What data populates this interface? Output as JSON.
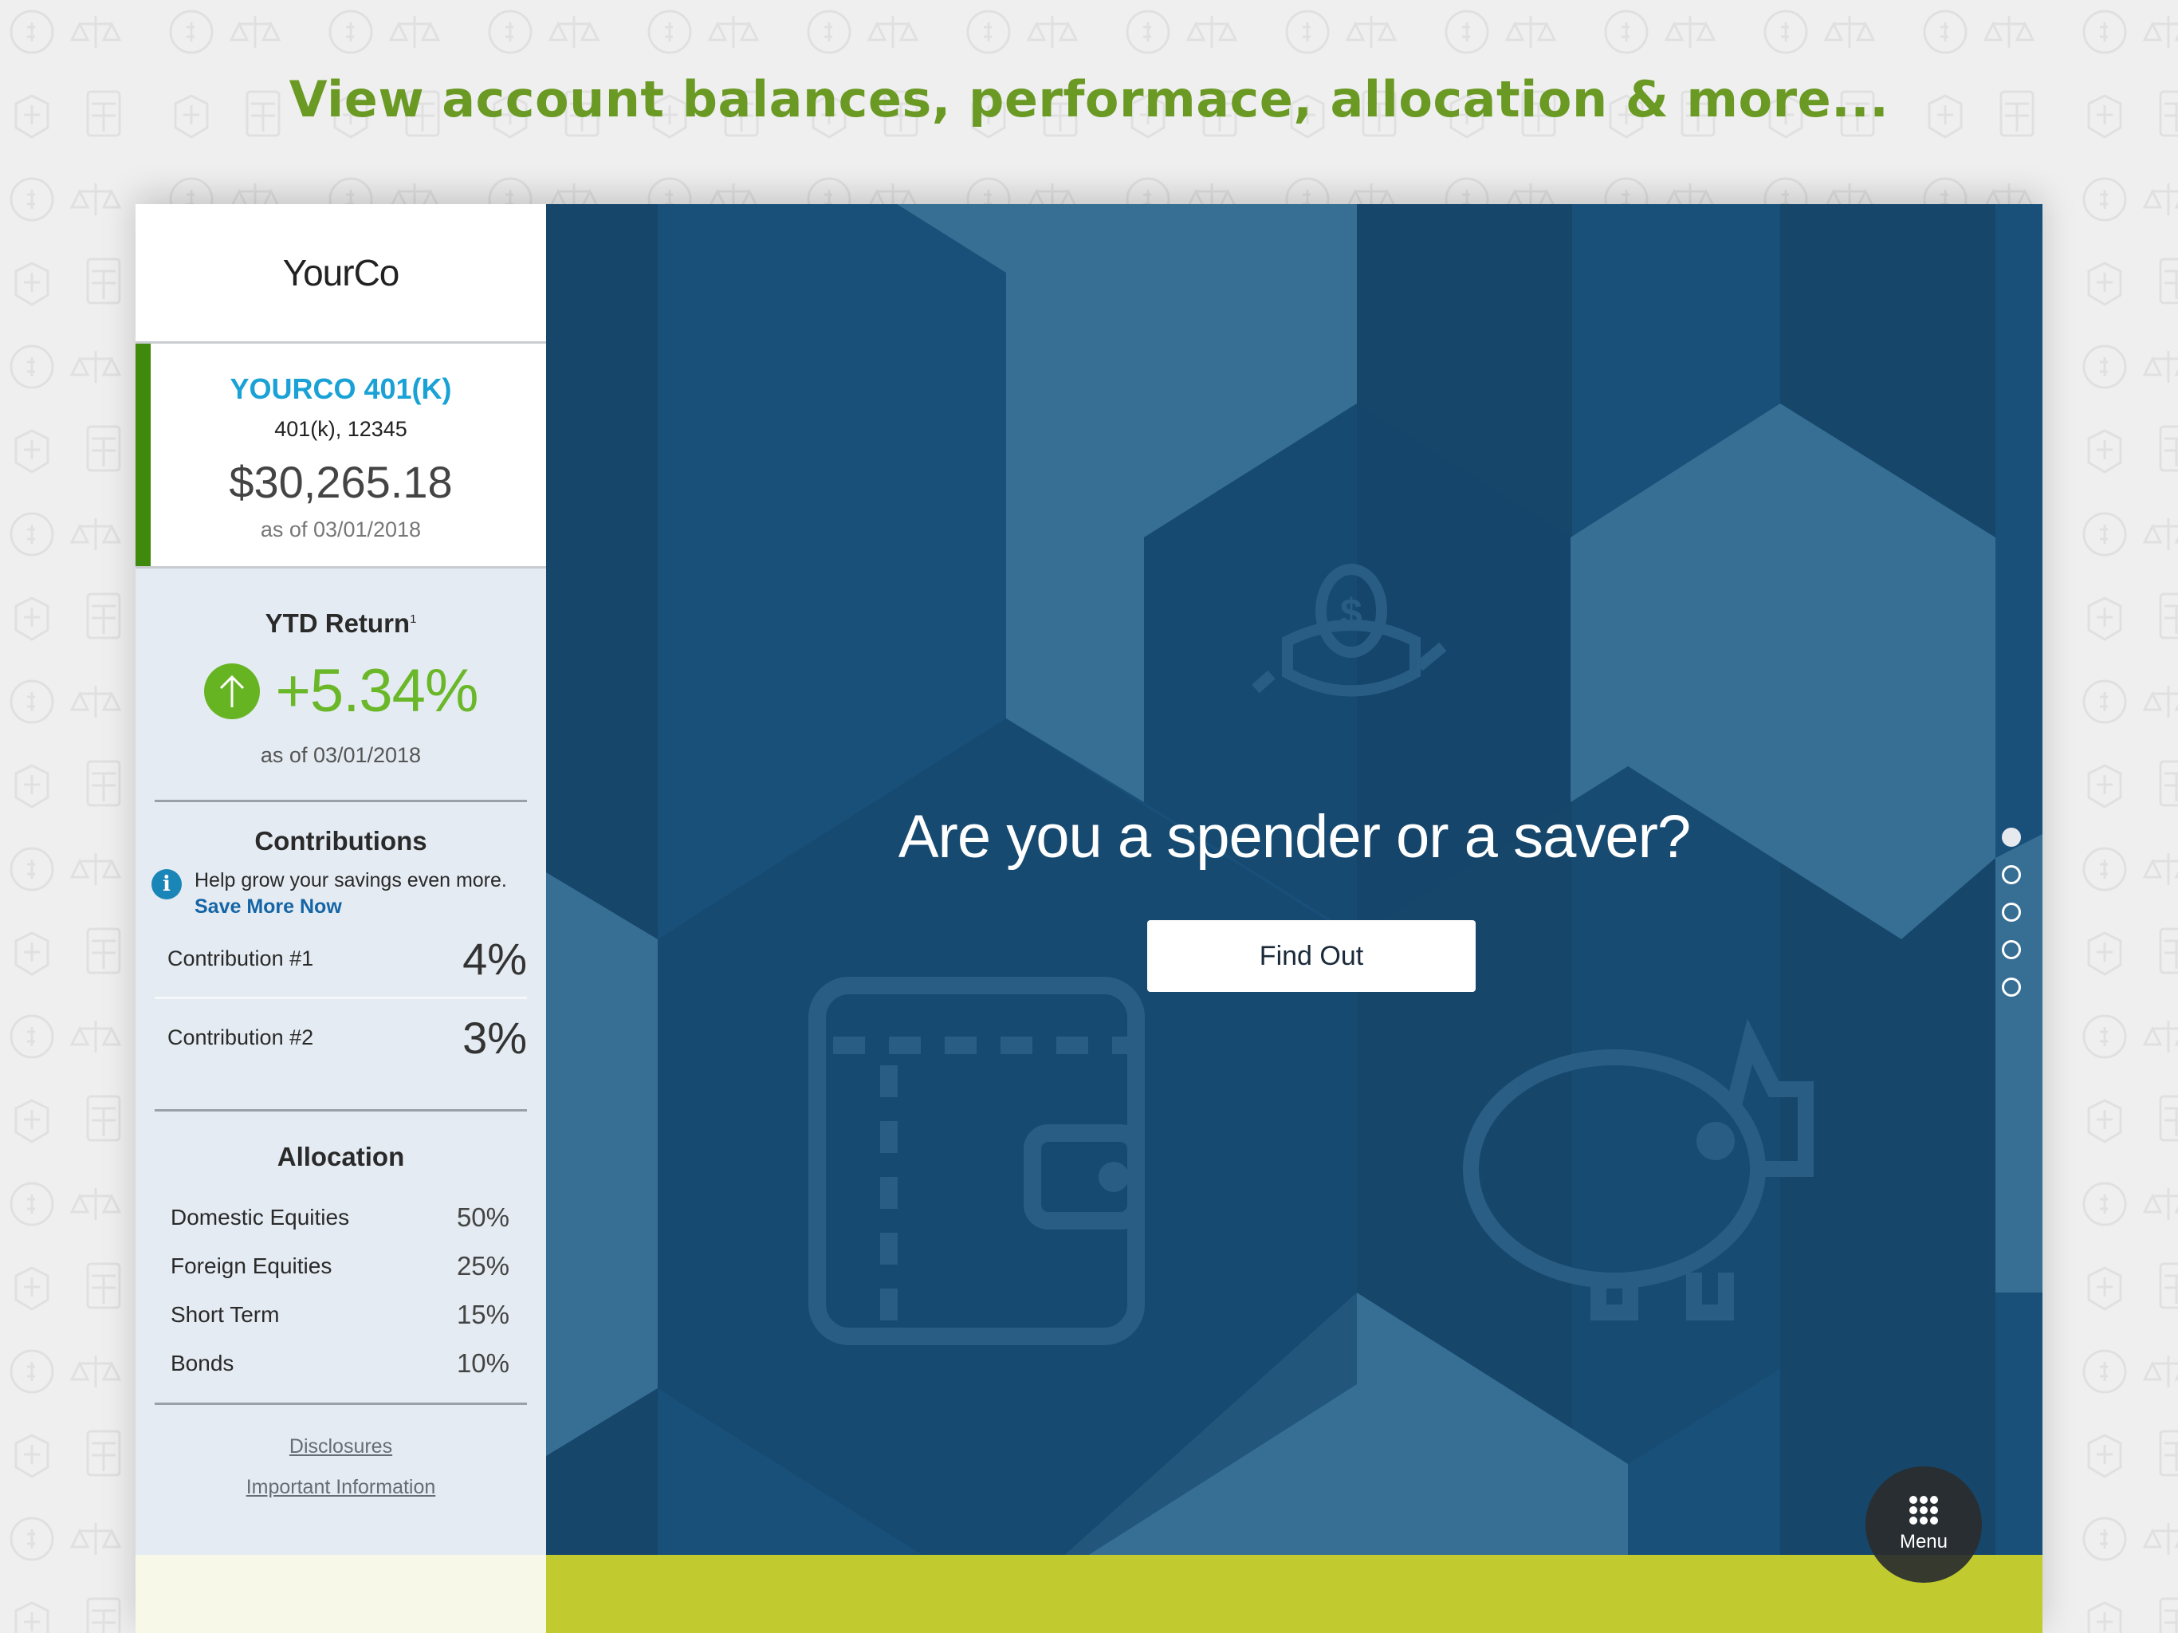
{
  "headline": "View account balances, performace, allocation & more...",
  "sidebar": {
    "brand": "YourCo",
    "account": {
      "name": "YOURCO 401(K)",
      "subtitle": "401(k), 12345",
      "balance": "$30,265.18",
      "as_of": "as of 03/01/2018"
    },
    "ytd": {
      "title": "YTD Return",
      "footnote": "1",
      "value": "+5.34%",
      "direction_icon": "arrow-up-icon",
      "as_of": "as of 03/01/2018"
    },
    "contributions": {
      "title": "Contributions",
      "info_text": "Help grow your savings even more.",
      "info_link": "Save More Now",
      "items": [
        {
          "label": "Contribution #1",
          "value": "4%"
        },
        {
          "label": "Contribution #2",
          "value": "3%"
        }
      ]
    },
    "allocation": {
      "title": "Allocation",
      "items": [
        {
          "label": "Domestic Equities",
          "value": "50%"
        },
        {
          "label": "Foreign Equities",
          "value": "25%"
        },
        {
          "label": "Short Term",
          "value": "15%"
        },
        {
          "label": "Bonds",
          "value": "10%"
        }
      ]
    },
    "links": {
      "disclosures": "Disclosures",
      "important_info": "Important Information"
    }
  },
  "hero": {
    "title": "Are you a spender or a saver?",
    "cta": "Find Out",
    "carousel": {
      "total": 5,
      "active_index": 0
    },
    "icons": [
      "coin-jar-icon",
      "wallet-icon",
      "piggy-bank-icon"
    ]
  },
  "menu": {
    "label": "Menu"
  },
  "colors": {
    "headline_green": "#6a9a23",
    "account_accent": "#3f8a0c",
    "account_name": "#1aa2d6",
    "ytd_green": "#6ab82a",
    "link_blue": "#1565a6",
    "hero_dark": "#16466a",
    "hero_mid": "#18507a",
    "hero_light": "#366e94",
    "bottom_bar": "#c1cb30"
  }
}
